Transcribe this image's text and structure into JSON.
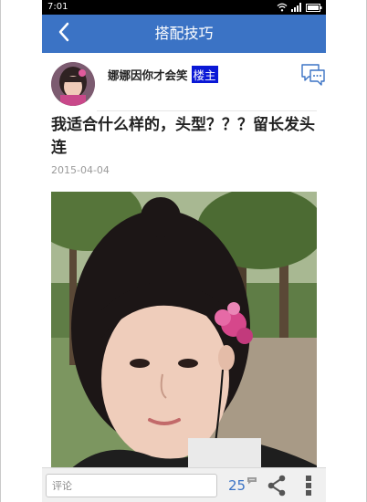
{
  "status_bar": {
    "time": "7:01",
    "icons": [
      "wifi-icon",
      "signal-icon",
      "battery-icon"
    ]
  },
  "nav": {
    "title": "搭配技巧",
    "back_icon": "chevron-left-icon",
    "background": "#3b73c5"
  },
  "post": {
    "author": {
      "name": "娜娜因你才会笑",
      "badge": "楼主",
      "badge_color": "#0a18d6"
    },
    "title": "我适合什么样的，头型？？？留长发头连",
    "date": "2015-04-04",
    "image_description": "portrait-photo"
  },
  "bottom_bar": {
    "comment_placeholder": "评论",
    "comment_count": "25",
    "share_icon": "share-icon",
    "more_icon": "more-vertical-icon",
    "accent": "#3b73c5"
  }
}
